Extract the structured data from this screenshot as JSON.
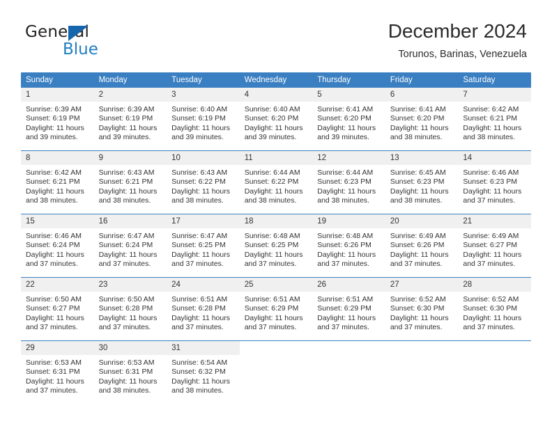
{
  "logo": {
    "text_primary": "General",
    "text_secondary": "Blue",
    "triangle_color": "#1666ad",
    "secondary_color": "#1f7ec4"
  },
  "header": {
    "title": "December 2024",
    "subtitle": "Torunos, Barinas, Venezuela"
  },
  "theme": {
    "header_bg": "#3a7fc1",
    "header_text": "#ffffff",
    "daynum_bg": "#f0f0f0",
    "row_divider": "#3a7fc1",
    "body_text": "#333333"
  },
  "calendar": {
    "weekday_headers": [
      "Sunday",
      "Monday",
      "Tuesday",
      "Wednesday",
      "Thursday",
      "Friday",
      "Saturday"
    ],
    "weeks": [
      [
        {
          "day": "1",
          "sunrise": "Sunrise: 6:39 AM",
          "sunset": "Sunset: 6:19 PM",
          "daylight_line1": "Daylight: 11 hours",
          "daylight_line2": "and 39 minutes."
        },
        {
          "day": "2",
          "sunrise": "Sunrise: 6:39 AM",
          "sunset": "Sunset: 6:19 PM",
          "daylight_line1": "Daylight: 11 hours",
          "daylight_line2": "and 39 minutes."
        },
        {
          "day": "3",
          "sunrise": "Sunrise: 6:40 AM",
          "sunset": "Sunset: 6:19 PM",
          "daylight_line1": "Daylight: 11 hours",
          "daylight_line2": "and 39 minutes."
        },
        {
          "day": "4",
          "sunrise": "Sunrise: 6:40 AM",
          "sunset": "Sunset: 6:20 PM",
          "daylight_line1": "Daylight: 11 hours",
          "daylight_line2": "and 39 minutes."
        },
        {
          "day": "5",
          "sunrise": "Sunrise: 6:41 AM",
          "sunset": "Sunset: 6:20 PM",
          "daylight_line1": "Daylight: 11 hours",
          "daylight_line2": "and 39 minutes."
        },
        {
          "day": "6",
          "sunrise": "Sunrise: 6:41 AM",
          "sunset": "Sunset: 6:20 PM",
          "daylight_line1": "Daylight: 11 hours",
          "daylight_line2": "and 38 minutes."
        },
        {
          "day": "7",
          "sunrise": "Sunrise: 6:42 AM",
          "sunset": "Sunset: 6:21 PM",
          "daylight_line1": "Daylight: 11 hours",
          "daylight_line2": "and 38 minutes."
        }
      ],
      [
        {
          "day": "8",
          "sunrise": "Sunrise: 6:42 AM",
          "sunset": "Sunset: 6:21 PM",
          "daylight_line1": "Daylight: 11 hours",
          "daylight_line2": "and 38 minutes."
        },
        {
          "day": "9",
          "sunrise": "Sunrise: 6:43 AM",
          "sunset": "Sunset: 6:21 PM",
          "daylight_line1": "Daylight: 11 hours",
          "daylight_line2": "and 38 minutes."
        },
        {
          "day": "10",
          "sunrise": "Sunrise: 6:43 AM",
          "sunset": "Sunset: 6:22 PM",
          "daylight_line1": "Daylight: 11 hours",
          "daylight_line2": "and 38 minutes."
        },
        {
          "day": "11",
          "sunrise": "Sunrise: 6:44 AM",
          "sunset": "Sunset: 6:22 PM",
          "daylight_line1": "Daylight: 11 hours",
          "daylight_line2": "and 38 minutes."
        },
        {
          "day": "12",
          "sunrise": "Sunrise: 6:44 AM",
          "sunset": "Sunset: 6:23 PM",
          "daylight_line1": "Daylight: 11 hours",
          "daylight_line2": "and 38 minutes."
        },
        {
          "day": "13",
          "sunrise": "Sunrise: 6:45 AM",
          "sunset": "Sunset: 6:23 PM",
          "daylight_line1": "Daylight: 11 hours",
          "daylight_line2": "and 38 minutes."
        },
        {
          "day": "14",
          "sunrise": "Sunrise: 6:46 AM",
          "sunset": "Sunset: 6:23 PM",
          "daylight_line1": "Daylight: 11 hours",
          "daylight_line2": "and 37 minutes."
        }
      ],
      [
        {
          "day": "15",
          "sunrise": "Sunrise: 6:46 AM",
          "sunset": "Sunset: 6:24 PM",
          "daylight_line1": "Daylight: 11 hours",
          "daylight_line2": "and 37 minutes."
        },
        {
          "day": "16",
          "sunrise": "Sunrise: 6:47 AM",
          "sunset": "Sunset: 6:24 PM",
          "daylight_line1": "Daylight: 11 hours",
          "daylight_line2": "and 37 minutes."
        },
        {
          "day": "17",
          "sunrise": "Sunrise: 6:47 AM",
          "sunset": "Sunset: 6:25 PM",
          "daylight_line1": "Daylight: 11 hours",
          "daylight_line2": "and 37 minutes."
        },
        {
          "day": "18",
          "sunrise": "Sunrise: 6:48 AM",
          "sunset": "Sunset: 6:25 PM",
          "daylight_line1": "Daylight: 11 hours",
          "daylight_line2": "and 37 minutes."
        },
        {
          "day": "19",
          "sunrise": "Sunrise: 6:48 AM",
          "sunset": "Sunset: 6:26 PM",
          "daylight_line1": "Daylight: 11 hours",
          "daylight_line2": "and 37 minutes."
        },
        {
          "day": "20",
          "sunrise": "Sunrise: 6:49 AM",
          "sunset": "Sunset: 6:26 PM",
          "daylight_line1": "Daylight: 11 hours",
          "daylight_line2": "and 37 minutes."
        },
        {
          "day": "21",
          "sunrise": "Sunrise: 6:49 AM",
          "sunset": "Sunset: 6:27 PM",
          "daylight_line1": "Daylight: 11 hours",
          "daylight_line2": "and 37 minutes."
        }
      ],
      [
        {
          "day": "22",
          "sunrise": "Sunrise: 6:50 AM",
          "sunset": "Sunset: 6:27 PM",
          "daylight_line1": "Daylight: 11 hours",
          "daylight_line2": "and 37 minutes."
        },
        {
          "day": "23",
          "sunrise": "Sunrise: 6:50 AM",
          "sunset": "Sunset: 6:28 PM",
          "daylight_line1": "Daylight: 11 hours",
          "daylight_line2": "and 37 minutes."
        },
        {
          "day": "24",
          "sunrise": "Sunrise: 6:51 AM",
          "sunset": "Sunset: 6:28 PM",
          "daylight_line1": "Daylight: 11 hours",
          "daylight_line2": "and 37 minutes."
        },
        {
          "day": "25",
          "sunrise": "Sunrise: 6:51 AM",
          "sunset": "Sunset: 6:29 PM",
          "daylight_line1": "Daylight: 11 hours",
          "daylight_line2": "and 37 minutes."
        },
        {
          "day": "26",
          "sunrise": "Sunrise: 6:51 AM",
          "sunset": "Sunset: 6:29 PM",
          "daylight_line1": "Daylight: 11 hours",
          "daylight_line2": "and 37 minutes."
        },
        {
          "day": "27",
          "sunrise": "Sunrise: 6:52 AM",
          "sunset": "Sunset: 6:30 PM",
          "daylight_line1": "Daylight: 11 hours",
          "daylight_line2": "and 37 minutes."
        },
        {
          "day": "28",
          "sunrise": "Sunrise: 6:52 AM",
          "sunset": "Sunset: 6:30 PM",
          "daylight_line1": "Daylight: 11 hours",
          "daylight_line2": "and 37 minutes."
        }
      ],
      [
        {
          "day": "29",
          "sunrise": "Sunrise: 6:53 AM",
          "sunset": "Sunset: 6:31 PM",
          "daylight_line1": "Daylight: 11 hours",
          "daylight_line2": "and 37 minutes."
        },
        {
          "day": "30",
          "sunrise": "Sunrise: 6:53 AM",
          "sunset": "Sunset: 6:31 PM",
          "daylight_line1": "Daylight: 11 hours",
          "daylight_line2": "and 38 minutes."
        },
        {
          "day": "31",
          "sunrise": "Sunrise: 6:54 AM",
          "sunset": "Sunset: 6:32 PM",
          "daylight_line1": "Daylight: 11 hours",
          "daylight_line2": "and 38 minutes."
        },
        null,
        null,
        null,
        null
      ]
    ]
  }
}
